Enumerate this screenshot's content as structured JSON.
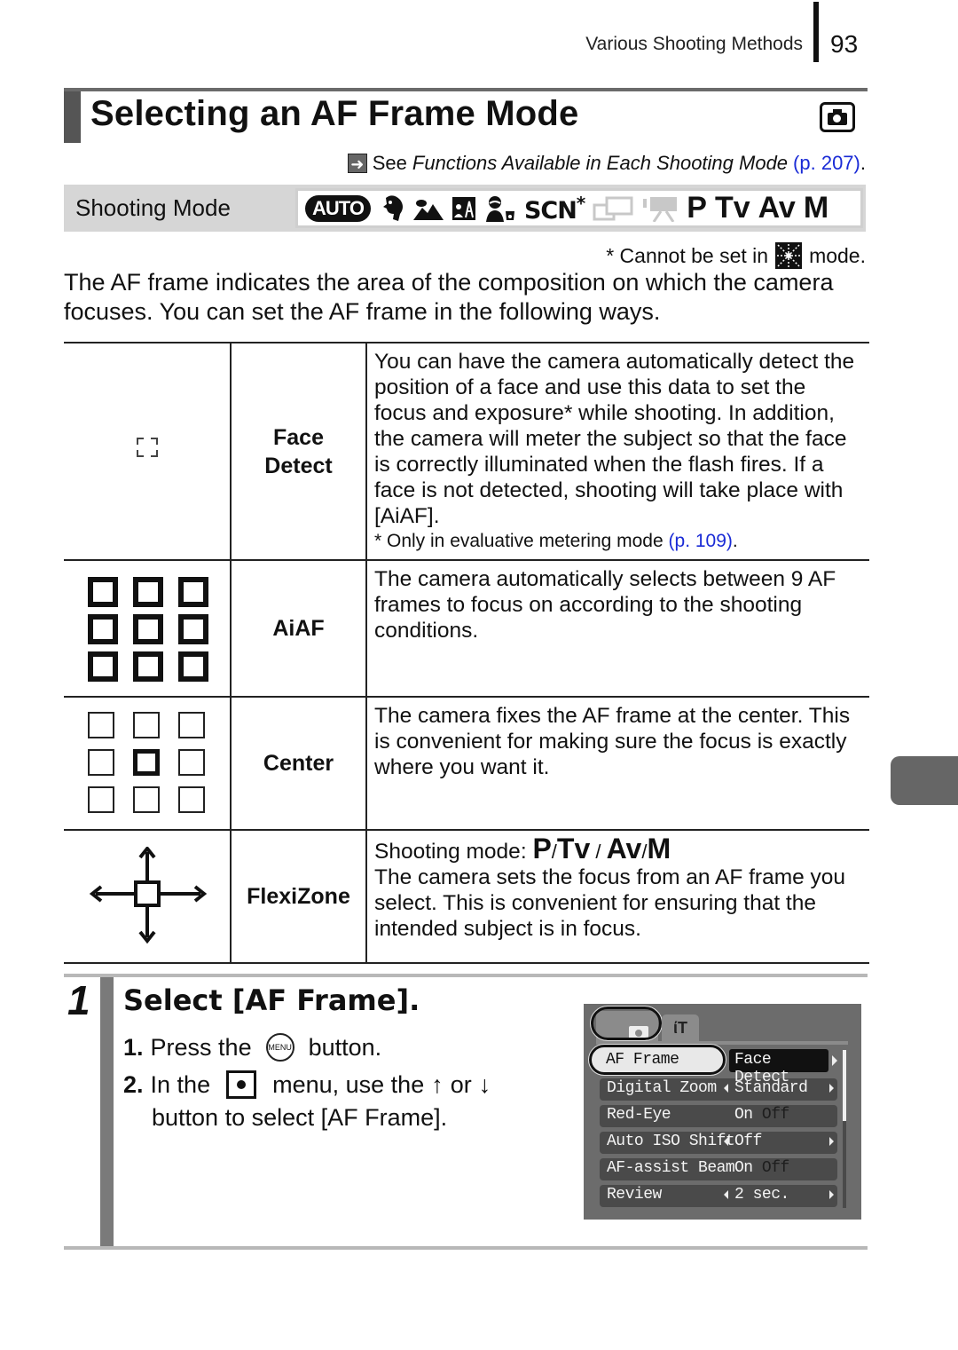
{
  "running_header": {
    "section": "Various Shooting Methods",
    "page_number": "93"
  },
  "title": "Selecting an AF Frame Mode",
  "title_icon": "camera-shooting-icon",
  "see_ref": {
    "prefix": "See",
    "italic_text": "Functions Available in Each Shooting Mode",
    "link": "(p. 207)",
    "suffix": "."
  },
  "shooting_mode": {
    "label": "Shooting Mode",
    "modes": [
      {
        "name": "AUTO",
        "icon": "auto-mode-icon",
        "available": true
      },
      {
        "name": "Portrait",
        "icon": "portrait-mode-icon",
        "available": true
      },
      {
        "name": "Landscape",
        "icon": "landscape-mode-icon",
        "available": true
      },
      {
        "name": "Night Snapshot",
        "icon": "night-snapshot-mode-icon",
        "available": true
      },
      {
        "name": "Kids & Pets",
        "icon": "kids-pets-mode-icon",
        "available": true
      },
      {
        "name": "SCN",
        "icon": "scn-mode-icon",
        "available": true,
        "note": "*"
      },
      {
        "name": "Stitch Assist",
        "icon": "stitch-assist-mode-icon",
        "available": false
      },
      {
        "name": "Movie",
        "icon": "movie-mode-icon",
        "available": false
      },
      {
        "name": "P",
        "available": true
      },
      {
        "name": "Tv",
        "available": true
      },
      {
        "name": "Av",
        "available": true
      },
      {
        "name": "M",
        "available": true
      }
    ],
    "scn_label": "SCN",
    "scn_asterisk": "*",
    "p": "P",
    "tv": "Tv",
    "av": "Av",
    "m": "M"
  },
  "cannot_note": {
    "prefix": "* Cannot be set in",
    "icon": "color-swap-mode-icon",
    "suffix": "mode."
  },
  "intro": "The AF frame indicates the area of the composition on which the camera focuses. You can set the AF frame in the following ways.",
  "af_modes": [
    {
      "icon": "face-detect-frame-icon",
      "name_line1": "Face",
      "name_line2": "Detect",
      "description": "You can have the camera automatically detect the position of a face and use this data to set the focus and exposure* while shooting. In addition, the camera will meter the subject so that the face is correctly illuminated when the flash fires. If a face is not detected, shooting will take place with [AiAF].",
      "footnote": "* Only in evaluative metering mode",
      "footnote_link": "(p. 109)",
      "footnote_suffix": "."
    },
    {
      "icon": "aiaf-nine-frames-icon",
      "name_line1": "AiAF",
      "description": "The camera automatically selects between 9 AF frames to focus on according to the shooting conditions."
    },
    {
      "icon": "center-frame-icon",
      "name_line1": "Center",
      "description": "The camera fixes the AF frame at the center. This is convenient for making sure the focus is exactly where you want it."
    },
    {
      "icon": "flexizone-frame-icon",
      "name_line1": "FlexiZone",
      "mode_prefix": "Shooting mode:",
      "modes": [
        "P",
        "Tv",
        "Av",
        "M"
      ],
      "separator": "/",
      "description": "The camera sets the focus from an AF frame you select. This is convenient for ensuring that the intended subject is in focus."
    }
  ],
  "step": {
    "number": "1",
    "title": "Select [AF Frame].",
    "instructions": [
      {
        "num": "1.",
        "before": "Press the",
        "icon": "menu-button-icon",
        "icon_text": "MENU",
        "after": "button."
      },
      {
        "num": "2.",
        "before": "In the",
        "icon": "shooting-menu-icon",
        "mid": "menu, use the",
        "up": "↑",
        "or": "or",
        "down": "↓",
        "continuation": "button to select [AF Frame]."
      }
    ]
  },
  "lcd_menu": {
    "tabs": [
      {
        "icon": "camera-tab-icon",
        "active": true
      },
      {
        "icon": "settings-tab-icon",
        "label": "ίT",
        "active": false
      }
    ],
    "rows": [
      {
        "label": "AF Frame",
        "value": "Face Detect",
        "selected": true
      },
      {
        "label": "Digital Zoom",
        "value": "Standard",
        "arrows": true
      },
      {
        "label": "Red-Eye",
        "value": "On",
        "alt": "Off"
      },
      {
        "label": "Auto ISO Shift",
        "value": "Off",
        "arrows": true
      },
      {
        "label": "AF-assist Beam",
        "value": "On",
        "alt": "Off"
      },
      {
        "label": "Review",
        "value": "2 sec.",
        "arrows": true
      }
    ]
  },
  "colors": {
    "link": "#1a2bd6",
    "title_bar": "#555555",
    "mode_bar_bg": "#d6d6d6",
    "lcd_bg": "#6c6c6c",
    "lcd_row_bg": "#4a4a4a",
    "side_tab": "#666666"
  }
}
